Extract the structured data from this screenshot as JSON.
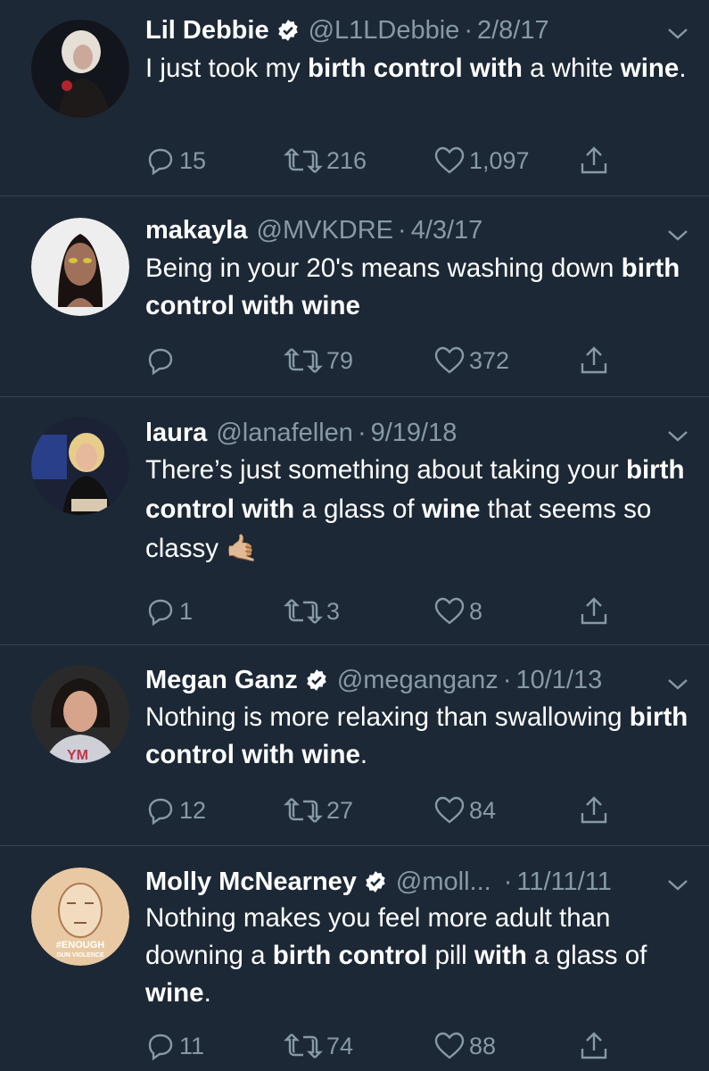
{
  "tweets": [
    {
      "name": "Lil Debbie",
      "verified": true,
      "handle": "@L1LDebbie",
      "date": "2/8/17",
      "text": [
        {
          "t": "I just took my ",
          "b": false
        },
        {
          "t": "birth control with",
          "b": true
        },
        {
          "t": " a white ",
          "b": false
        },
        {
          "t": "wine",
          "b": true
        },
        {
          "t": ".",
          "b": false
        }
      ],
      "replies": "15",
      "retweets": "216",
      "likes": "1,097"
    },
    {
      "name": "makayla",
      "verified": false,
      "handle": "@MVKDRE",
      "date": "4/3/17",
      "text": [
        {
          "t": "Being in your 20's means washing down ",
          "b": false
        },
        {
          "t": "birth control with wine",
          "b": true
        }
      ],
      "replies": "",
      "retweets": "79",
      "likes": "372"
    },
    {
      "name": "laura",
      "verified": false,
      "handle": "@lanafellen",
      "date": "9/19/18",
      "text": [
        {
          "t": "There’s just something about taking your ",
          "b": false
        },
        {
          "t": "birth control with",
          "b": true
        },
        {
          "t": " a glass of ",
          "b": false
        },
        {
          "t": "wine",
          "b": true
        },
        {
          "t": " that seems so classy ",
          "b": false
        }
      ],
      "emoji": "🤙🏼",
      "replies": "1",
      "retweets": "3",
      "likes": "8"
    },
    {
      "name": "Megan Ganz",
      "verified": true,
      "handle": "@meganganz",
      "date": "10/1/13",
      "text": [
        {
          "t": "Nothing is more relaxing than swallowing ",
          "b": false
        },
        {
          "t": "birth control with wine",
          "b": true
        },
        {
          "t": ".",
          "b": false
        }
      ],
      "replies": "12",
      "retweets": "27",
      "likes": "84"
    },
    {
      "name": "Molly McNearney",
      "verified": true,
      "handle": "@moll...",
      "date": "11/11/11",
      "text": [
        {
          "t": "Nothing makes you feel more adult than downing a ",
          "b": false
        },
        {
          "t": "birth control",
          "b": true
        },
        {
          "t": " pill ",
          "b": false
        },
        {
          "t": "with",
          "b": true
        },
        {
          "t": " a glass of ",
          "b": false
        },
        {
          "t": "wine",
          "b": true
        },
        {
          "t": ".",
          "b": false
        }
      ],
      "avatar_text": [
        "#ENOUGH",
        "GUN VIOLENCE"
      ],
      "replies": "11",
      "retweets": "74",
      "likes": "88"
    }
  ],
  "colors": {
    "background": "#1c2836",
    "secondary_text": "#8899a6",
    "divider": "#38444d",
    "verified_blue": "#1da1f2"
  }
}
